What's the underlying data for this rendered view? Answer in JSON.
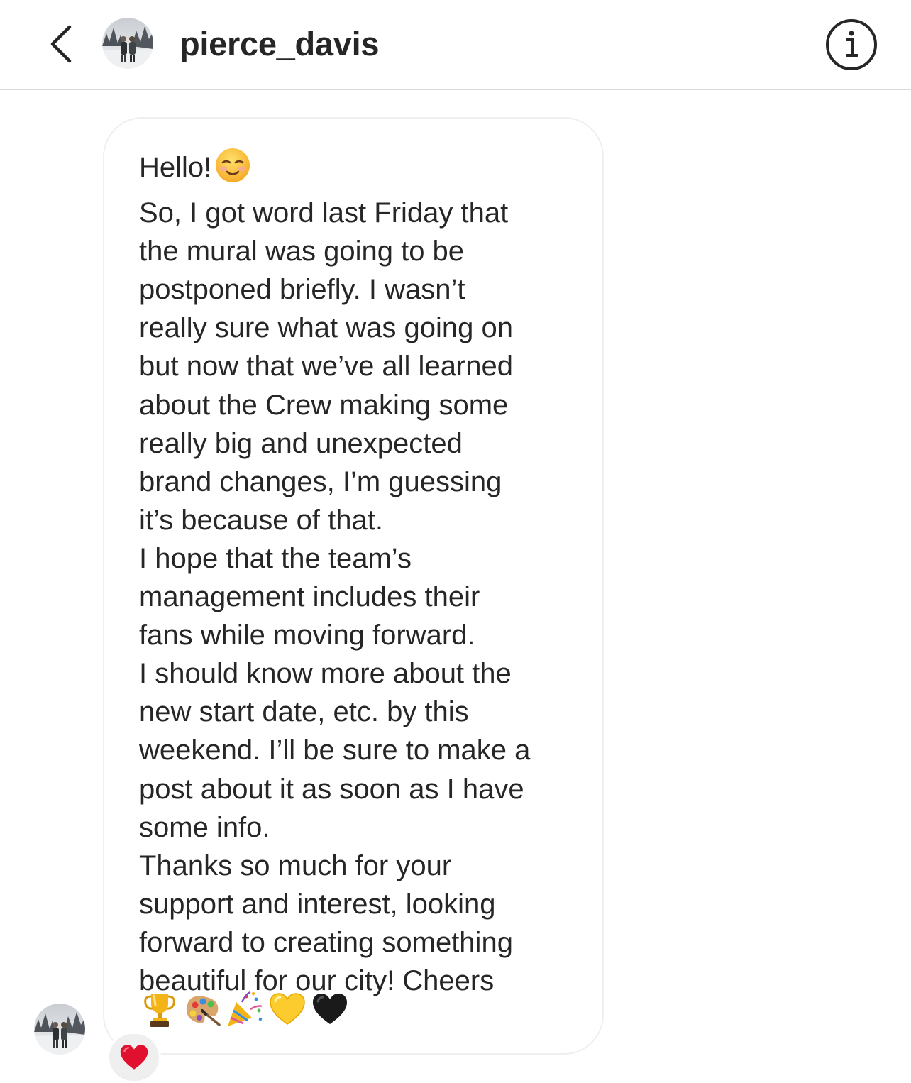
{
  "header": {
    "username": "pierce_davis",
    "back_icon": "chevron-left-icon",
    "info_icon": "info-circle-icon"
  },
  "message": {
    "lines": [
      "Hello!",
      "So, I got word last Friday that",
      "the mural was going to be",
      "postponed briefly. I wasn’t",
      "really sure what was going on",
      "but now that we’ve all learned",
      "about the Crew making some",
      "really big and unexpected",
      "brand changes, I’m guessing",
      "it’s because of that.",
      "I hope that the team’s",
      "management includes their",
      "fans while moving forward.",
      "I should know more about the",
      "new start date, etc. by this",
      "weekend. I’ll be sure to make a",
      "post about it as soon as I have",
      "some info.",
      "Thanks so much for your",
      "support and interest, looking",
      "forward to creating something",
      "beautiful for our city! Cheers"
    ],
    "greeting_emoji": "smiling-face-icon",
    "trailing_emojis": [
      "trophy-icon",
      "artist-palette-icon",
      "party-popper-icon",
      "yellow-heart-icon",
      "black-heart-icon"
    ]
  },
  "reaction": {
    "emoji": "red-heart-icon"
  },
  "colors": {
    "text": "#262626",
    "divider": "#dbdbdb",
    "bubble_border": "#efefef",
    "reaction_bg": "#efefef",
    "heart_red": "#e0102e"
  }
}
